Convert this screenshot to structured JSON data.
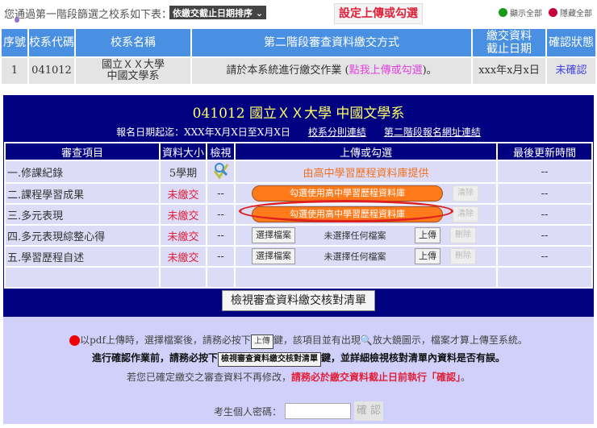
{
  "top": {
    "intro": "您通過第一階段篩選之校系如下表：",
    "sort": "依繳交截止日期排序",
    "set_button": "設定上傳或勾選",
    "show_all": "顯示全部",
    "hide_all": "隱藏全部"
  },
  "summary": {
    "headers": [
      "序號",
      "校系代碼",
      "校系名稱",
      "第二階段審查資料繳交方式",
      "繳交資料\n截止日期",
      "確認狀態"
    ],
    "row": {
      "no": "1",
      "code": "041012",
      "name1": "國立ＸＸ大學",
      "name2": "中國文學系",
      "method_pre": "請於本系統進行繳交作業 (",
      "method_link": "點我上傳或勾選",
      "method_post": ")。",
      "deadline": "xxx年x月x日",
      "status": "未確認"
    }
  },
  "panel": {
    "title": "041012 國立ＸＸ大學 中國文學系",
    "period": "報名日期起迄：XXX年X月X日至X月X日",
    "link1": "校系分則連結",
    "link2": "第二階段報名網址連結",
    "headers": [
      "審查項目",
      "資料大小",
      "檢視",
      "上傳或勾選",
      "最後更新時間"
    ],
    "rows": [
      {
        "item": "一.修課紀錄",
        "size": "5學期",
        "view": "",
        "upload": "由高中學習歷程資料庫提供",
        "updated": "--"
      },
      {
        "item": "二.課程學習成果",
        "size": "未繳交",
        "view": "--",
        "upload": "勾選使用高中學習歷程資料庫",
        "clear": "清除",
        "updated": "--"
      },
      {
        "item": "三.多元表現",
        "size": "未繳交",
        "view": "--",
        "upload": "勾選使用高中學習歷程資料庫",
        "clear": "清除",
        "updated": "--"
      },
      {
        "item": "四.多元表現綜整心得",
        "size": "未繳交",
        "view": "--",
        "choose": "選擇檔案",
        "nofile": "未選擇任何檔案",
        "upload": "上傳",
        "delete": "刪除",
        "updated": "--"
      },
      {
        "item": "五.學習歷程自述",
        "size": "未繳交",
        "view": "--",
        "choose": "選擇檔案",
        "nofile": "未選擇任何檔案",
        "upload": "上傳",
        "delete": "刪除",
        "updated": "--"
      }
    ]
  },
  "view_button": "檢視審查資料繳交核對清單",
  "notes": {
    "l1a": "以pdf上傳時，選擇檔案後，請務必按下",
    "l1btn": "上傳",
    "l1b": "鍵，該項目並有出現",
    "l1c": "放大鏡圖示，檔案才算上傳至系統。",
    "l2a": "進行確認作業前，請務必按下",
    "l2btn": "檢視審查資料繳交核對清單",
    "l2b": "鍵，並詳細檢視核對清單內資料是否有誤。",
    "l3a": "若您已確定繳交之審查資料不再修改，",
    "l3b": "請務必於繳交資料截止日前執行「確認」",
    "l3c": "。",
    "pw_label": "考生個人密碼：",
    "confirm": "確 認"
  }
}
